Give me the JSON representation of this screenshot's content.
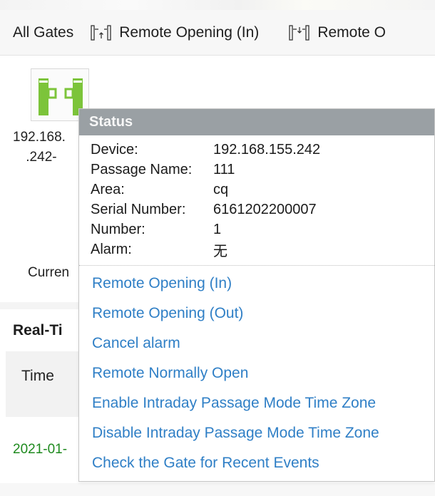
{
  "toolbar": {
    "all_gates": "All Gates",
    "remote_opening_in": "Remote Opening (In)",
    "remote_opening_out_partial": "Remote O"
  },
  "gate": {
    "label_line1": "192.168.",
    "label_line2": ".242-",
    "icon": "gate-turnstile-icon",
    "icon_color": "#7cc43a"
  },
  "current_label": "Curren",
  "realtime_title": "Real-Ti",
  "table": {
    "col_time": "Time",
    "row_date": "2021-01-"
  },
  "popup": {
    "title": "Status",
    "fields": [
      {
        "key": "Device:",
        "value": "192.168.155.242"
      },
      {
        "key": "Passage Name:",
        "value": "111"
      },
      {
        "key": "Area:",
        "value": "cq"
      },
      {
        "key": "Serial Number:",
        "value": "6161202200007"
      },
      {
        "key": "Number:",
        "value": "1"
      },
      {
        "key": "Alarm:",
        "value": "无"
      }
    ],
    "menu": [
      "Remote Opening (In)",
      "Remote Opening (Out)",
      "Cancel alarm",
      "Remote Normally Open",
      "Enable Intraday Passage Mode Time Zone",
      "Disable Intraday Passage Mode Time Zone",
      "Check the Gate for Recent Events"
    ]
  },
  "colors": {
    "link": "#2f7fc6",
    "header_bg": "#9aa0a4",
    "gate_green": "#7cc43a",
    "date_green": "#1e8a1e"
  }
}
